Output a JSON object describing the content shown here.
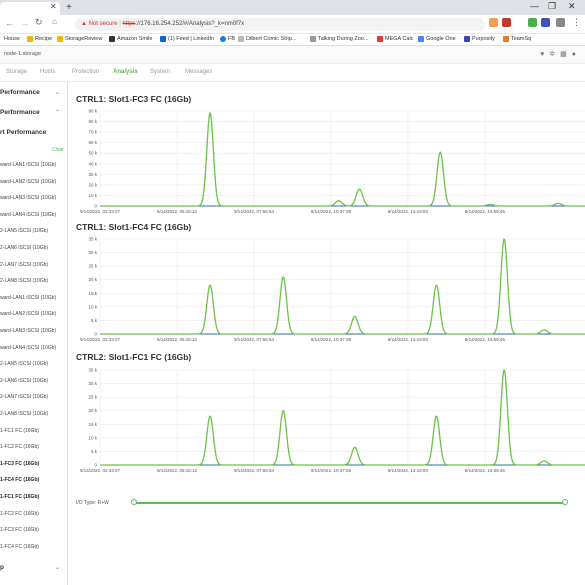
{
  "browser": {
    "tab_close": "✕",
    "new_tab": "+",
    "security": "Not secure",
    "url_https": "https",
    "url_rest": "://176.16.254.252/#/Analysis?_k=nm0f7x"
  },
  "bookmarks": [
    "House",
    "Recipe",
    "StorageReview",
    "Amazon Smile",
    "(1) Feed | LinkedIn",
    "FB",
    "Dilbert Comic Strip...",
    "Talking During Zoo...",
    "MEGA Calc",
    "Google One",
    "Purposity",
    "TeamSq"
  ],
  "app": {
    "host": "node-1.storage"
  },
  "nav": [
    "Storage",
    "Hosts",
    "Protection",
    "Analysis",
    "System",
    "Messages"
  ],
  "nav_active": "Analysis",
  "sidebar": {
    "sections": [
      "Performance",
      "Performance",
      "rt Performance"
    ],
    "clear": "Clear",
    "ports": [
      "ward-LAN1 iSCSI (10Gb)",
      "ward-LAN2 iSCSI (10Gb)",
      "ward-LAN3 iSCSI (10Gb)",
      "ward-LAN4 iSCSI (10Gb)",
      "2-LAN5 iSCSI (10Gb)",
      "2-LAN6 iSCSI (10Gb)",
      "2-LAN7 iSCSI (10Gb)",
      "2-LAN8 iSCSI (10Gb)",
      "ward-LAN1 iSCSI (10Gb)",
      "ward-LAN2 iSCSI (10Gb)",
      "ward-LAN3 iSCSI (10Gb)",
      "ward-LAN4 iSCSI (10Gb)",
      "2-LAN5 iSCSI (10Gb)",
      "2-LAN6 iSCSI (10Gb)",
      "2-LAN7 iSCSI (10Gb)",
      "2-LAN8 iSCSI (10Gb)",
      "1-FC1 FC (16Gb)",
      "1-FC2 FC (16Gb)",
      "1-FC3 FC (16Gb)",
      "1-FC4 FC (16Gb)",
      "1-FC1 FC (16Gb)",
      "1-FC2 FC (16Gb)",
      "1-FC3 FC (16Gb)",
      "1-FC4 FC (16Gb)"
    ],
    "bold_ports": [
      18,
      19,
      20
    ],
    "footer": "p"
  },
  "io_type_label": "I/O Type: R+W",
  "colors": {
    "accent": "#5cb85c",
    "line": "#6cc24a",
    "base": "#2f6f9f"
  },
  "chart_data": [
    {
      "type": "line",
      "title": "CTRL1: Slot1-FC3 FC (16Gb)",
      "y_ticks": [
        "90 k",
        "80 k",
        "70 k",
        "60 k",
        "50 k",
        "40 k",
        "30 k",
        "20 k",
        "10 k",
        "0"
      ],
      "ylim": [
        0,
        90000
      ],
      "x_ticks": [
        "9/14/2022, 02:33:07",
        "9/14/2022, 05:15:12",
        "9/14/2022, 07:55:54",
        "9/14/2022, 10:37:08",
        "9/14/2022, 13:19:00",
        "9/14/2022, 15:59:45"
      ],
      "x_range": [
        0,
        6.3
      ],
      "peaks": [
        {
          "x": 1.43,
          "y": 88000
        },
        {
          "x": 3.1,
          "y": 5000
        },
        {
          "x": 3.37,
          "y": 16000
        },
        {
          "x": 4.42,
          "y": 51000
        },
        {
          "x": 5.07,
          "y": 1500
        },
        {
          "x": 5.95,
          "y": 2500
        }
      ]
    },
    {
      "type": "line",
      "title": "CTRL1: Slot1-FC4 FC (16Gb)",
      "y_ticks": [
        "35 k",
        "30 k",
        "25 k",
        "20 k",
        "15 k",
        "10 k",
        "5 k",
        "0"
      ],
      "ylim": [
        0,
        35000
      ],
      "x_ticks": [
        "9/14/2022, 02:33:07",
        "9/14/2022, 05:15:12",
        "9/14/2022, 07:55:54",
        "9/14/2022, 10:37:08",
        "9/14/2022, 13:19:00",
        "9/14/2022, 15:59:45"
      ],
      "x_range": [
        0,
        6.3
      ],
      "peaks": [
        {
          "x": 1.43,
          "y": 18000
        },
        {
          "x": 2.38,
          "y": 21000
        },
        {
          "x": 3.31,
          "y": 6500
        },
        {
          "x": 4.37,
          "y": 18000
        },
        {
          "x": 5.25,
          "y": 35000
        },
        {
          "x": 5.77,
          "y": 1500
        }
      ]
    },
    {
      "type": "line",
      "title": "CTRL2: Slot1-FC1 FC (16Gb)",
      "y_ticks": [
        "35 k",
        "30 k",
        "25 k",
        "20 k",
        "15 k",
        "10 k",
        "5 k",
        "0"
      ],
      "ylim": [
        0,
        35000
      ],
      "x_ticks": [
        "9/14/2022, 02:33:07",
        "9/14/2022, 05:15:12",
        "9/14/2022, 07:55:54",
        "9/14/2022, 10:37:08",
        "9/14/2022, 13:19:00",
        "9/14/2022, 15:59:45"
      ],
      "x_range": [
        0,
        6.3
      ],
      "peaks": [
        {
          "x": 1.43,
          "y": 18000
        },
        {
          "x": 2.38,
          "y": 20000
        },
        {
          "x": 3.31,
          "y": 6500
        },
        {
          "x": 4.37,
          "y": 18000
        },
        {
          "x": 5.25,
          "y": 35000
        },
        {
          "x": 5.77,
          "y": 1500
        }
      ]
    }
  ]
}
